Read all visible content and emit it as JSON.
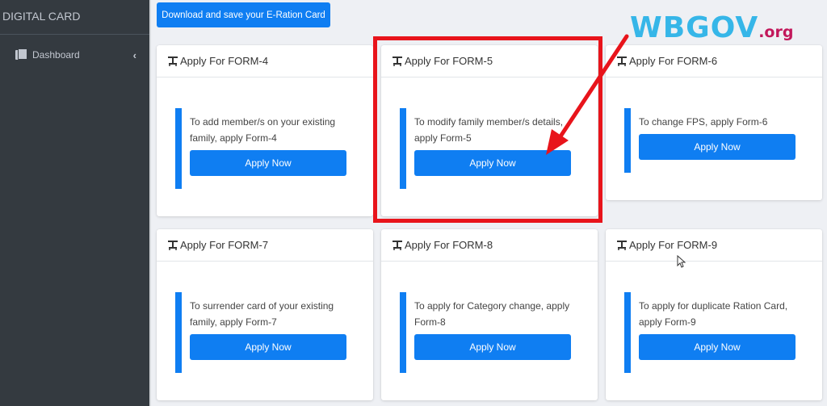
{
  "sidebar": {
    "brand": "DIGITAL CARD",
    "items": [
      {
        "label": "Dashboard",
        "icon": "copy-icon",
        "chevron": "‹"
      }
    ]
  },
  "main": {
    "download_button": "Download and save your E-Ration Card",
    "cards": [
      {
        "title": "Apply For FORM-4",
        "description": "To add member/s on your existing family, apply Form-4",
        "button": "Apply Now"
      },
      {
        "title": "Apply For FORM-5",
        "description": "To modify family member/s details, apply Form-5",
        "button": "Apply Now"
      },
      {
        "title": "Apply For FORM-6",
        "description": "To change FPS, apply Form-6",
        "button": "Apply Now"
      },
      {
        "title": "Apply For FORM-7",
        "description": "To surrender card of your existing family, apply Form-7",
        "button": "Apply Now"
      },
      {
        "title": "Apply For FORM-8",
        "description": "To apply for Category change, apply Form-8",
        "button": "Apply Now"
      },
      {
        "title": "Apply For FORM-9",
        "description": "To apply for duplicate Ration Card, apply Form-9",
        "button": "Apply Now"
      }
    ]
  },
  "overlay": {
    "watermark_main": "WBGOV",
    "watermark_suffix": ".org",
    "highlight_color": "#e8141b",
    "accent_color": "#0f7ef2"
  }
}
